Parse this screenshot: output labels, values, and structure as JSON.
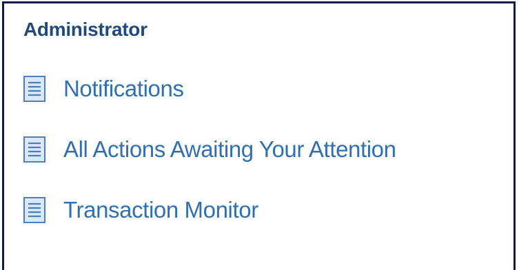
{
  "section": {
    "title": "Administrator"
  },
  "menu": {
    "items": [
      {
        "label": "Notifications",
        "icon": "document-icon"
      },
      {
        "label": "All Actions Awaiting Your Attention",
        "icon": "document-icon"
      },
      {
        "label": "Transaction Monitor",
        "icon": "document-icon"
      }
    ]
  },
  "colors": {
    "border": "#0c1c4c",
    "title": "#1f4a7a",
    "link": "#2f70b3",
    "icon_fill": "#dbe8f7",
    "icon_stroke": "#4d7fbd"
  }
}
